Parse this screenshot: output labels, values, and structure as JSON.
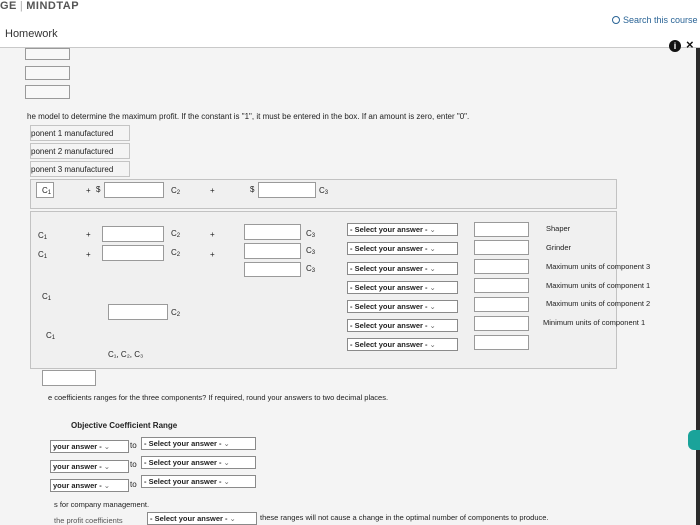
{
  "header": {
    "brand_left": "GE",
    "brand_right": "MINDTAP",
    "section": "Homework",
    "search_label": "Search this course"
  },
  "instructions": "he model to determine the maximum profit. If the constant is \"1\", it must be entered in the box. If an amount is zero, enter \"0\".",
  "components": [
    "ponent 1 manufactured",
    "ponent 2 manufactured",
    "ponent 3 manufactured"
  ],
  "model": {
    "c1": "C",
    "plus": "+",
    "dollar": "$",
    "c2": "C",
    "c3": "C",
    "sub1": "1",
    "sub2": "2",
    "sub3": "3",
    "nonneg": "C₁, C₂, C₃"
  },
  "select_placeholder": "- Select your answer -",
  "constraints": [
    "Shaper",
    "Grinder",
    "Maximum units of component 3",
    "Maximum units of component 1",
    "Maximum units of component 2",
    "Minimum units of component 1"
  ],
  "ranges": {
    "question": "e coefficients ranges for the three components? If required, round your answers to two decimal places.",
    "table_header": "Objective Coefficient Range",
    "left_select": "your answer -",
    "to": "to",
    "right_select": "- Select your answer -"
  },
  "footer": {
    "line1": "s for company management.",
    "line2_prefix": "the profit coefficients",
    "line2_select": "- Select your answer -",
    "line2_suffix": "these ranges will not cause a change in the optimal number of components to produce."
  }
}
